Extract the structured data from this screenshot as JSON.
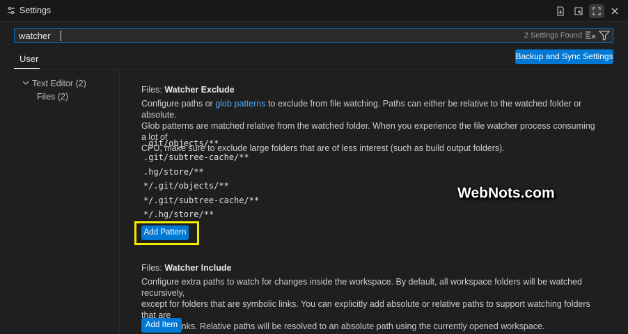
{
  "window": {
    "title": "Settings",
    "icons": [
      "settings-icon",
      "open-json-icon",
      "split-editor-icon",
      "maximize-icon",
      "close-icon"
    ]
  },
  "search": {
    "value": "watcher",
    "results_count": "2 Settings Found",
    "icons": [
      "clear-filter-icon",
      "filter-icon"
    ]
  },
  "scope_tabs": [
    {
      "label": "User",
      "active": true
    }
  ],
  "backup_sync_label": "Backup and Sync Settings",
  "toc": [
    {
      "label": "Text Editor (2)",
      "expanded": true
    },
    {
      "label": "Files (2)"
    }
  ],
  "settings": [
    {
      "category": "Files: ",
      "name": "Watcher Exclude",
      "desc_before_link": "Configure paths or ",
      "link_text": "glob patterns",
      "desc_line1_after": " to exclude from file watching. Paths can either be relative to the watched folder or absolute.",
      "desc_line2": "Glob patterns are matched relative from the watched folder. When you experience the file watcher process consuming a lot of",
      "desc_line3": "CPU, make sure to exclude large folders that are of less interest (such as build output folders).",
      "patterns": [
        ".git/objects/**",
        ".git/subtree-cache/**",
        ".hg/store/**",
        "*/.git/objects/**",
        "*/.git/subtree-cache/**",
        "*/.hg/store/**"
      ],
      "button_label": "Add Pattern"
    },
    {
      "category": "Files: ",
      "name": "Watcher Include",
      "desc_line1": "Configure extra paths to watch for changes inside the workspace. By default, all workspace folders will be watched recursively,",
      "desc_line2": "except for folders that are symbolic links. You can explicitly add absolute or relative paths to support watching folders that are",
      "desc_line3": "symbolic links. Relative paths will be resolved to an absolute path using the currently opened workspace.",
      "button_label": "Add Item"
    }
  ],
  "watermark": "WebNots.com",
  "colors": {
    "accent": "#0078d4",
    "link": "#4daafc",
    "highlight": "#f5ec00",
    "background": "#1f1f1f"
  }
}
